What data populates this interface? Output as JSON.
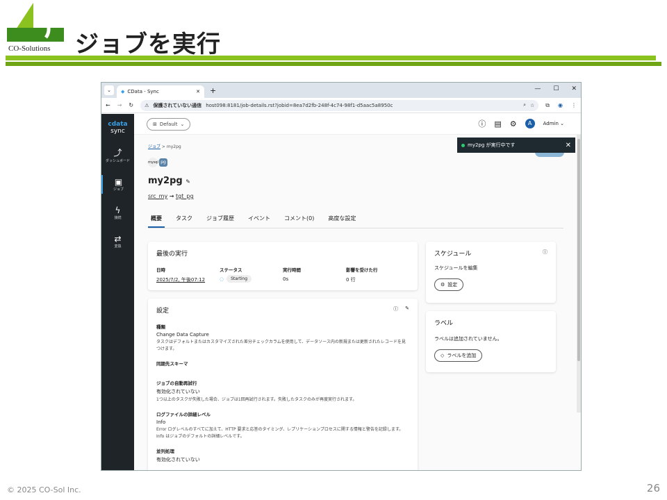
{
  "slide": {
    "title": "ジョブを実行",
    "logo_text": "CO-Solutions",
    "footer": "© 2025 CO-Sol Inc.",
    "page_number": "26",
    "accent_green": "#8cc21f"
  },
  "browser": {
    "tab_title": "CData - Sync",
    "security_label": "保護されていない通信",
    "url": "host098:8181/job-details.rst?jobid=8ea7d2fb-248f-4c74-98f1-d5aac5a8950c"
  },
  "sidebar": {
    "logo_top": "cdata",
    "logo_bottom": "sync",
    "items": [
      {
        "label": "ダッシュボード",
        "icon": "chart-icon"
      },
      {
        "label": "ジョブ",
        "icon": "briefcase-icon"
      },
      {
        "label": "接続",
        "icon": "plug-icon"
      },
      {
        "label": "変換",
        "icon": "transform-icon"
      }
    ]
  },
  "topbar": {
    "workspace": "Default",
    "user": "Admin",
    "avatar_letter": "A"
  },
  "toast": {
    "message": "my2pg が実行中です"
  },
  "job": {
    "breadcrumb_root": "ジョブ",
    "breadcrumb_current": "my2pg",
    "name": "my2pg",
    "source": "src_my",
    "arrow": "→",
    "destination": "tgt_pg",
    "connector_src": "mysql",
    "connector_dst": "pg"
  },
  "tabs": [
    "概要",
    "タスク",
    "ジョブ履歴",
    "イベント",
    "コメント(0)",
    "高度な設定"
  ],
  "last_run": {
    "title": "最後の実行",
    "date_label": "日時",
    "date_value": "2025/7/2, 午後07:12",
    "status_label": "ステータス",
    "status_value": "Starting",
    "duration_label": "実行時間",
    "duration_value": "0s",
    "rows_label": "影響を受けた行",
    "rows_value": "0 行"
  },
  "schedule": {
    "title": "スケジュール",
    "text": "スケジュールを編集",
    "button": "設定"
  },
  "labels": {
    "title": "ラベル",
    "text": "ラベルは追加されていません。",
    "button": "ラベルを追加"
  },
  "settings": {
    "title": "設定",
    "type_label": "種類",
    "type_value": "Change Data Capture",
    "type_desc": "タスクはデフォルトまたはカスタマイズされた差分チェックカラムを使用して、データソース内の新規または更新されたレコードを見つけます。",
    "schema_label": "同期先スキーマ",
    "retry_label": "ジョブの自動再試行",
    "retry_value": "有効化されていない",
    "retry_desc": "1つ以上のタスクが失敗した場合、ジョブは1回再試行されます。失敗したタスクのみが再度実行されます。",
    "log_label": "ログファイルの詳細レベル",
    "log_value": "Info",
    "log_desc": "Error ログレベルのすべてに加えて、HTTP 要求と応答のタイミング、レプリケーションプロセスに関する情報と警告を記録します。Info はジョブのデフォルトの詳細レベルです。",
    "parallel_label": "並列処理",
    "parallel_value": "有効化されていない"
  }
}
